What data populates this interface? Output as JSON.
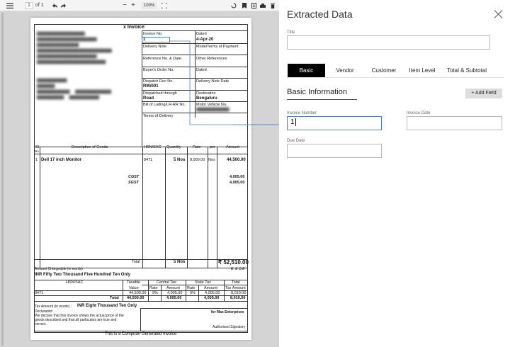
{
  "viewer": {
    "page_current": "1",
    "page_of": "of 1",
    "zoom": "100%"
  },
  "invoice": {
    "title_partial": "x Invoice",
    "invoice_no_label": "Invoice No.",
    "invoice_no_value": "1",
    "dated_label": "Dated",
    "dated_value": "4-Apr-20",
    "delivery_note_label": "Delivery Note",
    "mode_terms_label": "Mode/Terms of Payment",
    "ref_no_label": "Reference No. & Date.",
    "other_refs_label": "Other References",
    "buyers_order_label": "Buyer's Order No.",
    "dated2_label": "Dated",
    "dispatch_doc_label": "Dispatch Doc No.",
    "dispatch_doc_value": "RW/001",
    "delivery_note_date_label": "Delivery Note Date",
    "dispatched_through_label": "Dispatched through",
    "dispatched_through_value": "Road",
    "destination_label": "Destination",
    "destination_value": "Bengaluru",
    "bill_lading_label": "Bill of Lading/LR-RR No.",
    "motor_vehicle_label": "Motor Vehicle No.",
    "terms_delivery_label": "Terms of Delivery",
    "col_sl": "Sl",
    "col_no": "No.",
    "col_desc": "Description of Goods",
    "col_hsn": "HSN/SAC",
    "col_qty": "Quantity",
    "col_rate": "Rate",
    "col_per": "per",
    "col_amount": "Amount",
    "item_sl": "1",
    "item_desc": "Dell 17 inch Monitor",
    "item_hsn": "8471",
    "item_qty": "5 Nos",
    "item_rate": "8,900.00",
    "item_per": "Nos",
    "item_amount": "44,500.00",
    "cgst_label": "CGST",
    "sgst_label": "SGST",
    "cgst_amount": "4,005.00",
    "sgst_amount": "4,005.00",
    "total_label": "Total",
    "total_qty": "5 Nos",
    "total_amount": "₹ 52,510.00",
    "amount_words_label": "Amount Chargeable (in words)",
    "eoe": "E. & O.E",
    "amount_words": "INR Fifty Two Thousand Five Hundred Ten Only",
    "tax_hsn": "HSN/SAC",
    "tax_taxable": "Taxable",
    "tax_value": "Value",
    "tax_central": "Central Tax",
    "tax_state": "State Tax",
    "tax_total": "Total",
    "tax_rate": "Rate",
    "tax_amount": "Amount",
    "tax_amount2": "Amount",
    "tax_rate2": "Rate",
    "tax_tax_amount": "Tax Amount",
    "tax_row_hsn": "8471",
    "tax_row_taxable": "44,500.00",
    "tax_row_crate": "9%",
    "tax_row_camt": "4,005.00",
    "tax_row_srate": "9%",
    "tax_row_samt": "4,005.00",
    "tax_row_total": "8,010.00",
    "tax_total_label": "Total",
    "tax_total_taxable": "44,500.00",
    "tax_total_camt": "4,005.00",
    "tax_total_samt": "4,005.00",
    "tax_total_total": "8,010.00",
    "tax_words_label": "Tax Amount (in words) :",
    "tax_words": "INR Eight Thousand Ten Only",
    "declaration_label": "Declaration",
    "declaration_text_1": "We declare that this invoice shows the actual price of the",
    "declaration_text_2": "goods described and that all particulars are true and",
    "declaration_text_3": "correct.",
    "for_company": "for Max Enterprises",
    "auth_sign": "Authorised Signatory",
    "footer": "This is a Computer Generated Invoice"
  },
  "panel": {
    "title": "Extracted Data",
    "title_field_label": "Title",
    "title_field_value": "",
    "tabs": [
      "Basic",
      "Vendor",
      "Customer",
      "Item Level",
      "Total & Subtotal"
    ],
    "section_title": "Basic Information",
    "add_field_label": "+ Add Field",
    "invoice_number_label": "Invoice Number",
    "invoice_number_value": "1",
    "invoice_date_label": "Invoice Date",
    "invoice_date_value": "",
    "due_date_label": "Due Date",
    "due_date_value": ""
  },
  "colors": {
    "accent": "#4a7fd4",
    "active_tab": "#000000"
  }
}
